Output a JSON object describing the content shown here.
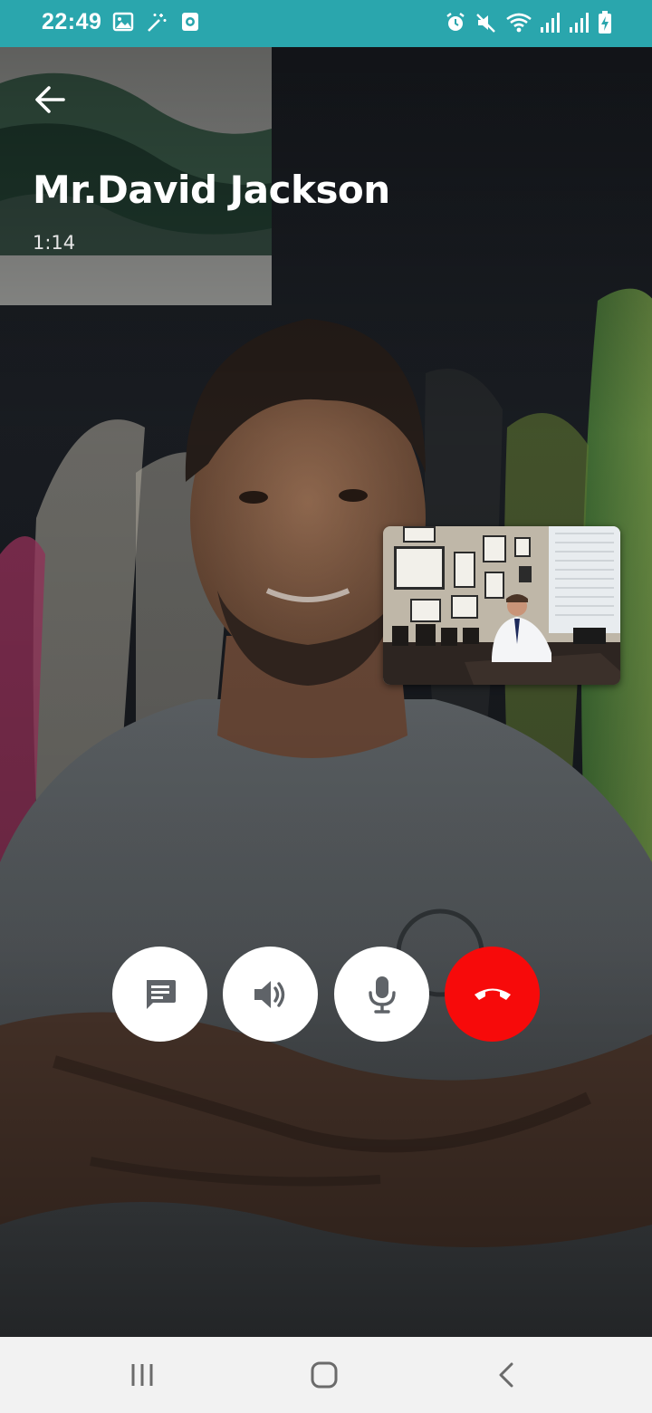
{
  "status_bar": {
    "time": "22:49",
    "background_color": "#2aa6ad",
    "left_icons": [
      "image-icon",
      "magic-wand-icon",
      "screen-record-icon"
    ],
    "right_icons": [
      "alarm-icon",
      "mute-icon",
      "wifi-icon",
      "signal-icon",
      "signal-icon",
      "battery-charging-icon"
    ]
  },
  "call": {
    "caller_name": "Mr.David Jackson",
    "duration": "1:14"
  },
  "controls": {
    "chat_icon": "chat-icon",
    "speaker_icon": "speaker-icon",
    "mic_icon": "microphone-icon",
    "end_icon": "end-call-icon",
    "end_color": "#f70a0a"
  },
  "navigation": {
    "recents_icon": "recents-icon",
    "home_icon": "home-icon",
    "back_icon": "back-icon"
  }
}
